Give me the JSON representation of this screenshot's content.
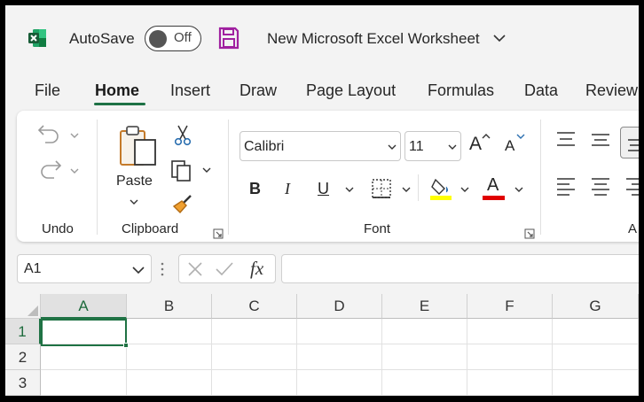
{
  "titlebar": {
    "autosave_label": "AutoSave",
    "autosave_state": "Off",
    "document_title": "New Microsoft Excel Worksheet"
  },
  "menu": {
    "tabs": [
      "File",
      "Home",
      "Insert",
      "Draw",
      "Page Layout",
      "Formulas",
      "Data",
      "Review"
    ],
    "active_tab": "Home"
  },
  "ribbon": {
    "groups": {
      "undo": "Undo",
      "clipboard": "Clipboard",
      "font": "Font",
      "alignment_partial": "A"
    },
    "paste_label": "Paste",
    "font_name": "Calibri",
    "font_size": "11",
    "grow_font_glyph": "A",
    "shrink_font_glyph": "A",
    "bold_glyph": "B",
    "italic_glyph": "I",
    "underline_glyph": "U",
    "font_color_glyph": "A",
    "highlight_color": "#ffff00",
    "font_color": "#e00000"
  },
  "formula_bar": {
    "name_box": "A1",
    "fx_label": "fx",
    "formula": ""
  },
  "grid": {
    "columns": [
      "A",
      "B",
      "C",
      "D",
      "E",
      "F",
      "G"
    ],
    "rows": [
      "1",
      "2",
      "3"
    ],
    "selected_cell": "A1"
  },
  "colors": {
    "accent": "#217346",
    "save_icon": "#a020a0"
  }
}
